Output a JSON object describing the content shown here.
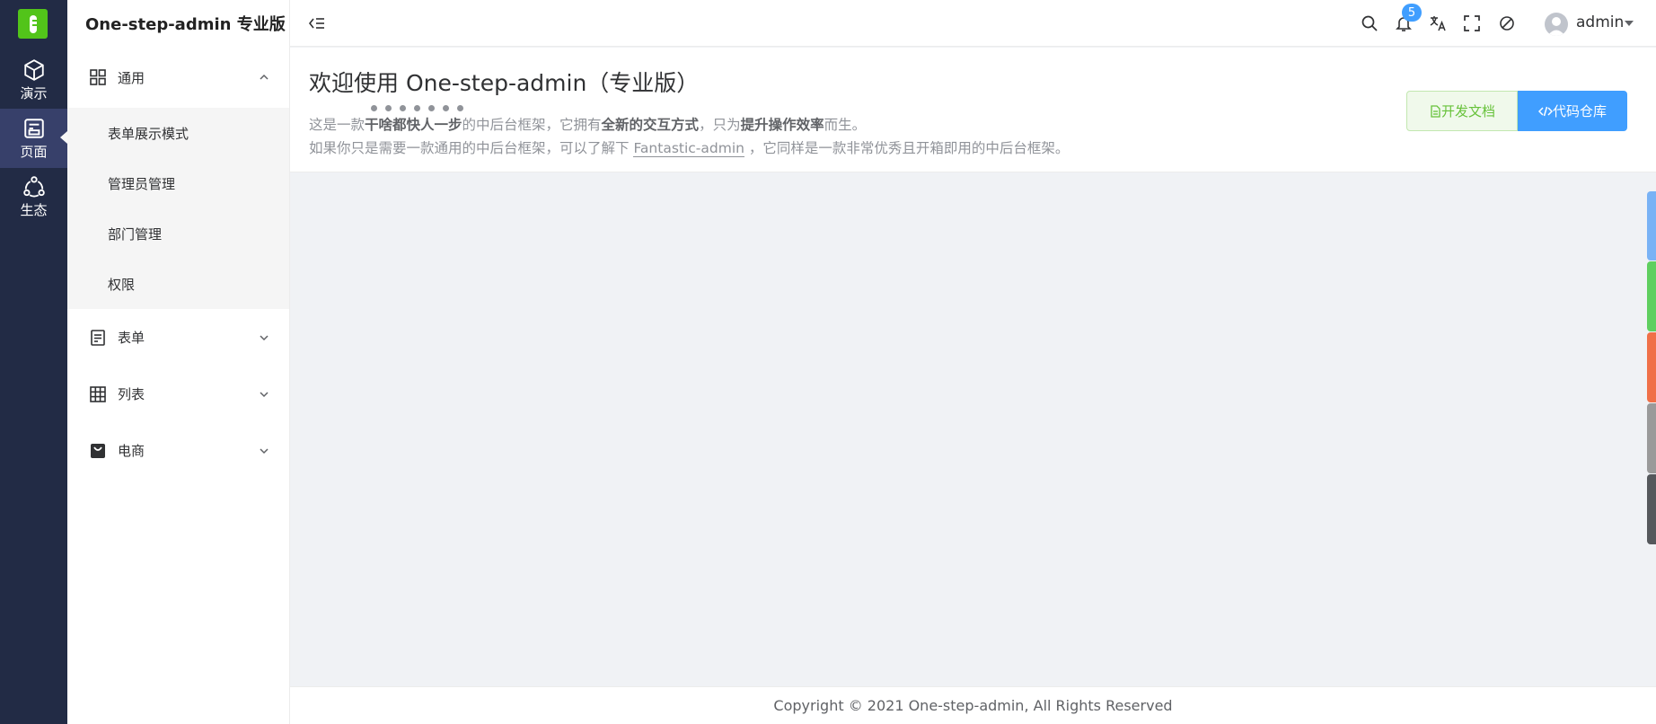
{
  "rail": {
    "items": [
      {
        "label": "演示",
        "icon": "cube-icon"
      },
      {
        "label": "页面",
        "icon": "page-icon"
      },
      {
        "label": "生态",
        "icon": "ecosystem-icon"
      }
    ]
  },
  "sidebar": {
    "title": "One-step-admin 专业版",
    "groups": [
      {
        "label": "通用",
        "icon": "grid-icon",
        "expanded": true,
        "items": [
          {
            "label": "表单展示模式"
          },
          {
            "label": "管理员管理"
          },
          {
            "label": "部门管理"
          },
          {
            "label": "权限"
          }
        ]
      },
      {
        "label": "表单",
        "icon": "document-icon",
        "expanded": false
      },
      {
        "label": "列表",
        "icon": "table-icon",
        "expanded": false
      },
      {
        "label": "电商",
        "icon": "shopping-bag-icon",
        "expanded": false
      }
    ]
  },
  "topbar": {
    "notification_count": "5",
    "user": "admin"
  },
  "header": {
    "title": "欢迎使用 One-step-admin（专业版）",
    "line1": {
      "p1": "这是一款",
      "b1": "干啥都快人一步",
      "p2": "的中后台框架，它拥有",
      "b2": "全新的交互方式",
      "p3": "，只为",
      "b3": "提升操作效率",
      "p4": "而生。"
    },
    "line2": {
      "p1": "如果你只是需要一款通用的中后台框架，可以了解下 ",
      "link": "Fantastic-admin",
      "p2": " ，它同样是一款非常优秀且开箱即用的中后台框架。"
    },
    "btn_doc": "开发文档",
    "btn_repo": "代码仓库"
  },
  "colors": {
    "rail": "#222b45",
    "primary": "#409eff",
    "success": "#67c23a",
    "tabs": [
      "#79b2f5",
      "#5fcf5f",
      "#f07048",
      "#9a9a9a",
      "#55585c"
    ]
  },
  "footer": {
    "text": "Copyright © 2021 One-step-admin, All Rights Reserved"
  }
}
